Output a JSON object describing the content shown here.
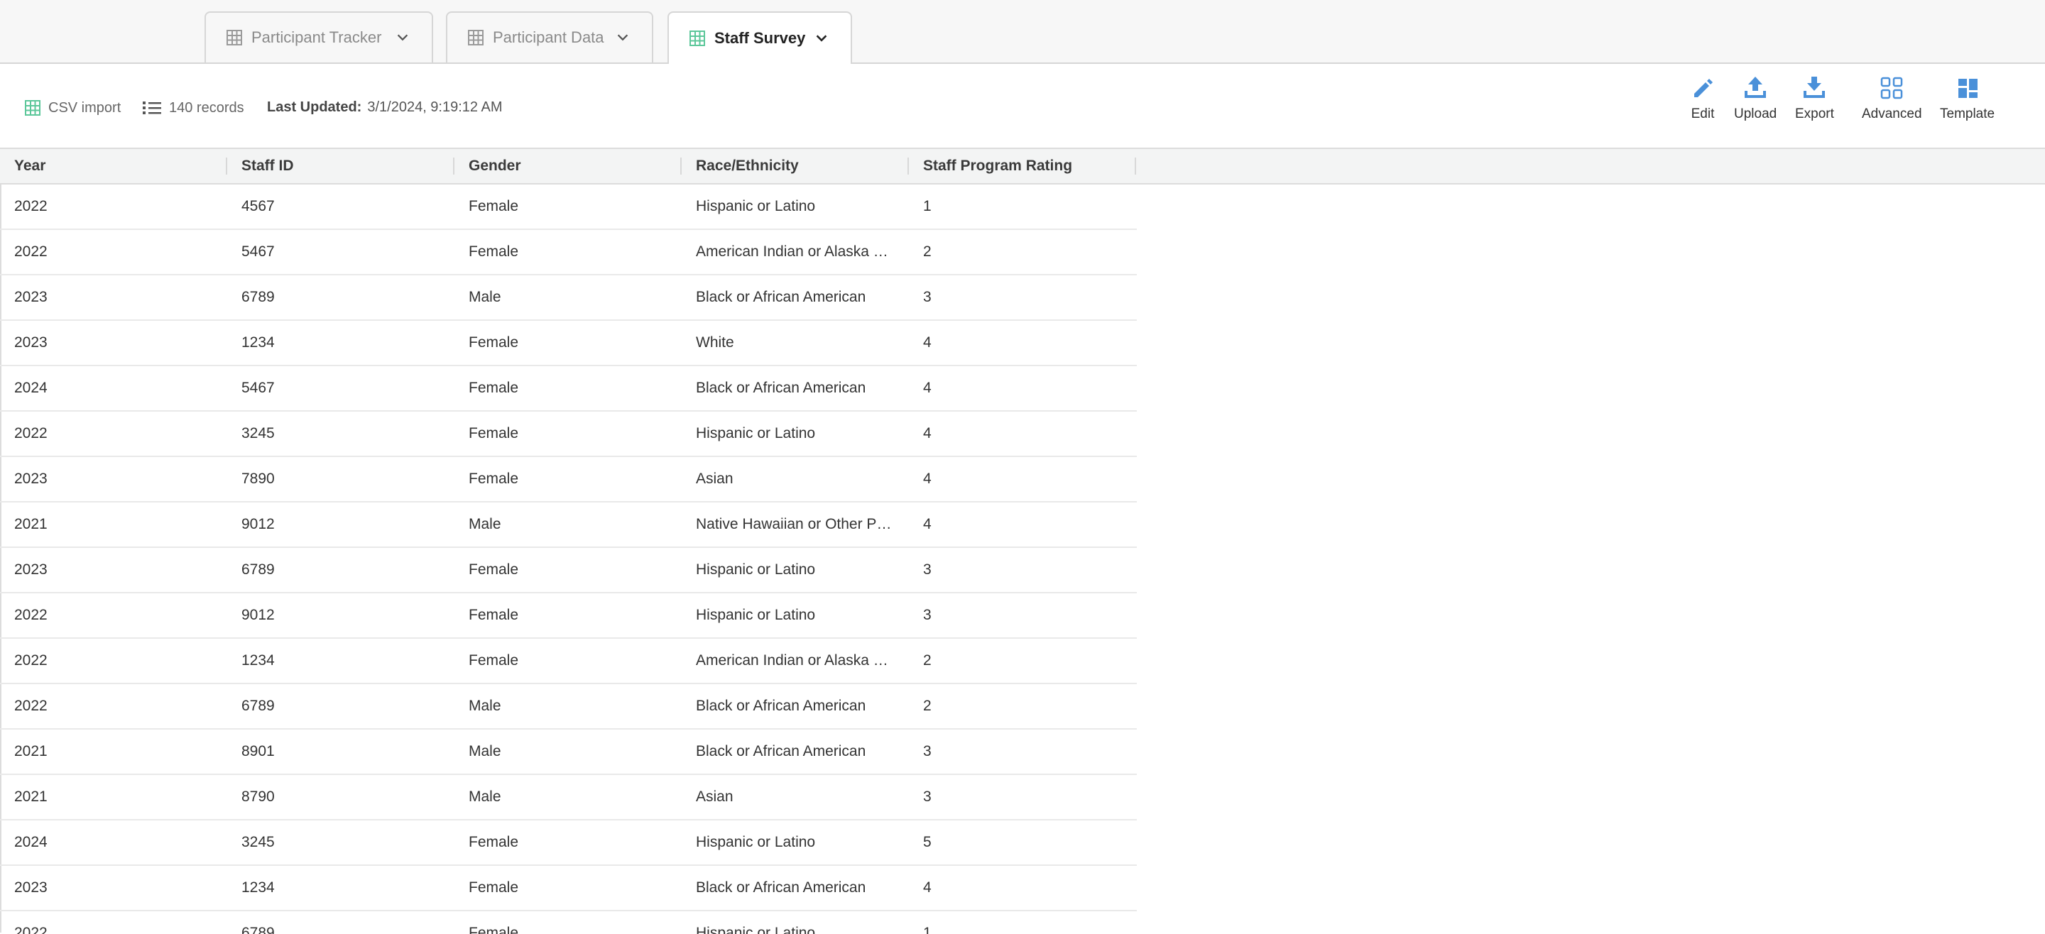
{
  "tabs": [
    {
      "label": "Participant Tracker"
    },
    {
      "label": "Participant Data"
    },
    {
      "label": "Staff Survey"
    }
  ],
  "info": {
    "source": "CSV import",
    "records": "140 records",
    "last_updated_label": "Last Updated:",
    "last_updated_value": "3/1/2024, 9:19:12 AM"
  },
  "toolbar": {
    "edit": "Edit",
    "upload": "Upload",
    "export": "Export",
    "advanced": "Advanced",
    "template": "Template"
  },
  "colors": {
    "accent": "#4a90d9",
    "sheet_icon": "#5cc79a",
    "active_tab_text": "#222222"
  },
  "table": {
    "columns": [
      "Year",
      "Staff ID",
      "Gender",
      "Race/Ethnicity",
      "Staff Program Rating"
    ],
    "rows": [
      [
        "2022",
        "4567",
        "Female",
        "Hispanic or Latino",
        "1"
      ],
      [
        "2022",
        "5467",
        "Female",
        "American Indian or Alaska Native",
        "2"
      ],
      [
        "2023",
        "6789",
        "Male",
        "Black or African American",
        "3"
      ],
      [
        "2023",
        "1234",
        "Female",
        "White",
        "4"
      ],
      [
        "2024",
        "5467",
        "Female",
        "Black or African American",
        "4"
      ],
      [
        "2022",
        "3245",
        "Female",
        "Hispanic or Latino",
        "4"
      ],
      [
        "2023",
        "7890",
        "Female",
        "Asian",
        "4"
      ],
      [
        "2021",
        "9012",
        "Male",
        "Native Hawaiian or Other Pacific Islander",
        "4"
      ],
      [
        "2023",
        "6789",
        "Female",
        "Hispanic or Latino",
        "3"
      ],
      [
        "2022",
        "9012",
        "Female",
        "Hispanic or Latino",
        "3"
      ],
      [
        "2022",
        "1234",
        "Female",
        "American Indian or Alaska Native",
        "2"
      ],
      [
        "2022",
        "6789",
        "Male",
        "Black or African American",
        "2"
      ],
      [
        "2021",
        "8901",
        "Male",
        "Black or African American",
        "3"
      ],
      [
        "2021",
        "8790",
        "Male",
        "Asian",
        "3"
      ],
      [
        "2024",
        "3245",
        "Female",
        "Hispanic or Latino",
        "5"
      ],
      [
        "2023",
        "1234",
        "Female",
        "Black or African American",
        "4"
      ],
      [
        "2022",
        "6789",
        "Female",
        "Hispanic or Latino",
        "1"
      ]
    ]
  }
}
